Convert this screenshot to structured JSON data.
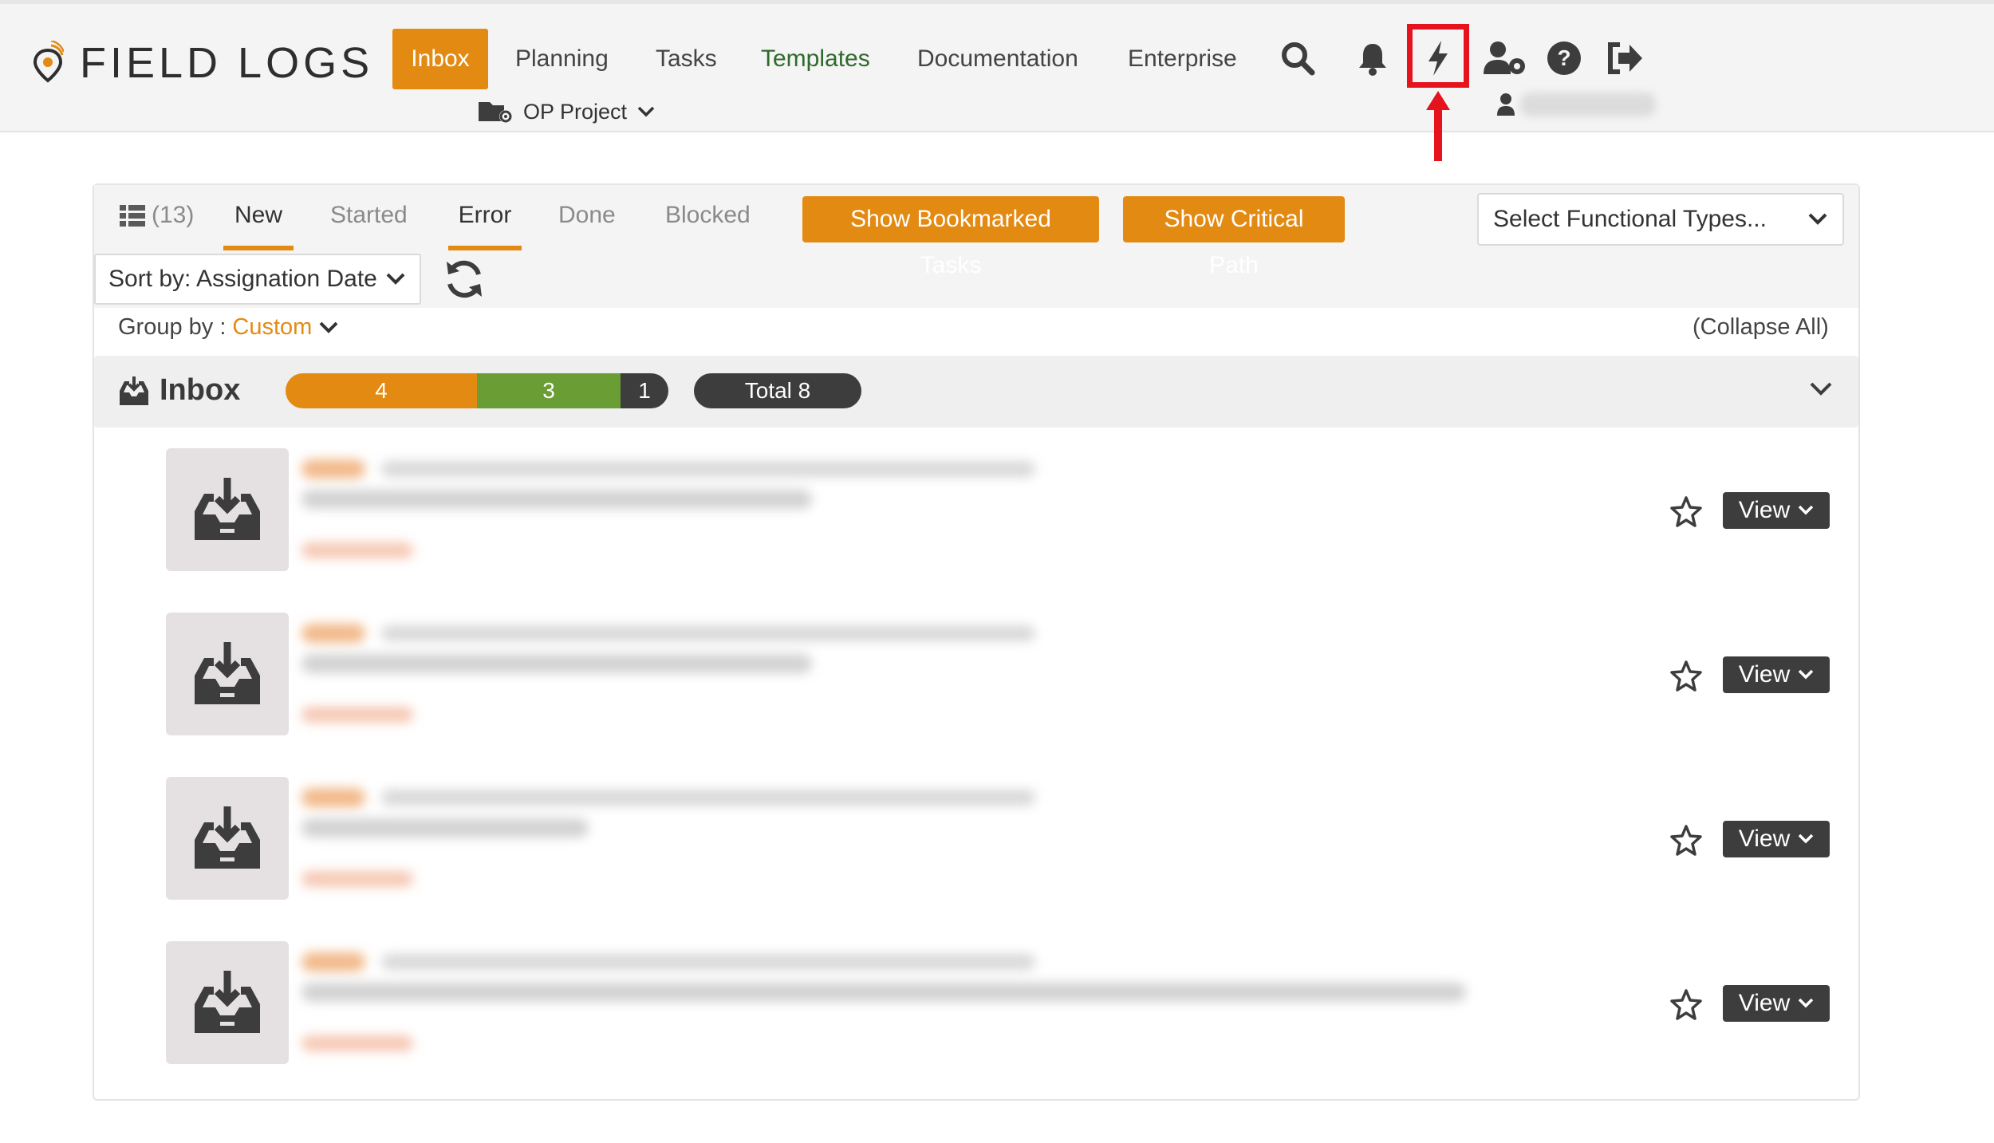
{
  "app": {
    "logo_text": "FIELD LOGS"
  },
  "nav": {
    "items": [
      {
        "label": "Inbox"
      },
      {
        "label": "Planning"
      },
      {
        "label": "Tasks"
      },
      {
        "label": "Templates"
      },
      {
        "label": "Documentation"
      },
      {
        "label": "Enterprise"
      }
    ],
    "project": "OP Project",
    "icons": [
      "search-icon",
      "bell-icon",
      "lightning-icon",
      "user-settings-icon",
      "help-icon",
      "logout-icon"
    ]
  },
  "tabs": {
    "list_count": "(13)",
    "items": [
      {
        "label": "New"
      },
      {
        "label": "Started"
      },
      {
        "label": "Error"
      },
      {
        "label": "Done"
      },
      {
        "label": "Blocked"
      }
    ],
    "bookmarked_label": "Show Bookmarked Tasks",
    "critical_label": "Show Critical Path",
    "functional_select": "Select Functional Types..."
  },
  "controls": {
    "sort_label": "Sort by: Assignation Date",
    "group_label": "Group by :",
    "group_value": "Custom",
    "collapse_label": "(Collapse All)"
  },
  "inbox": {
    "title": "Inbox",
    "progress": [
      {
        "value": "4",
        "count": 4,
        "color": "#e38a13"
      },
      {
        "value": "3",
        "count": 3,
        "color": "#6a9e34"
      },
      {
        "value": "1",
        "count": 1,
        "color": "#3d3d3d"
      }
    ],
    "total_label": "Total 8"
  },
  "rows": [
    {
      "view_label": "View"
    },
    {
      "view_label": "View"
    },
    {
      "view_label": "View"
    },
    {
      "view_label": "View"
    }
  ],
  "colors": {
    "accent": "#e38a13",
    "highlight": "#e5131d",
    "dark": "#3d3d3d",
    "green": "#6a9e34"
  }
}
